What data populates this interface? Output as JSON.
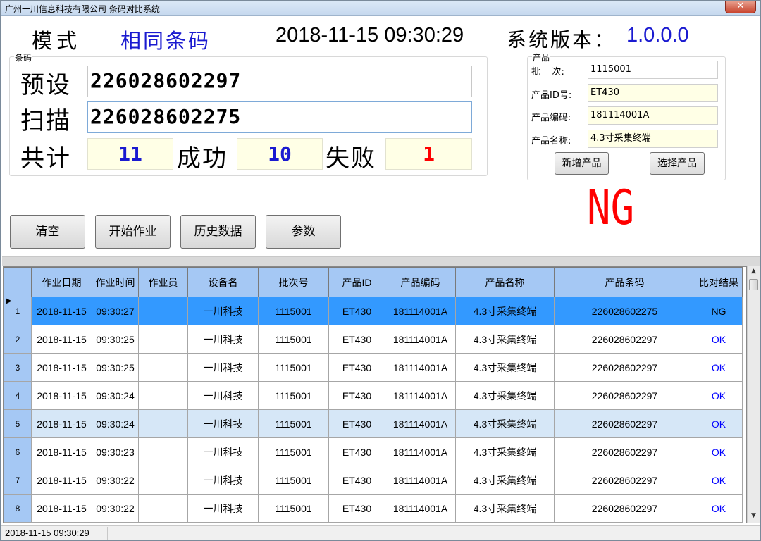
{
  "window": {
    "title": "广州一川信息科技有限公司 条码对比系统",
    "close_label": "✕"
  },
  "header": {
    "mode_label": "模式",
    "mode_value": "相同条码",
    "datetime": "2018-11-15 09:30:29",
    "version_label": "系统版本：",
    "version_value": "1.0.0.0"
  },
  "barcode": {
    "group_title": "条码",
    "preset_label": "预设",
    "preset_value": "226028602297",
    "scan_label": "扫描",
    "scan_value": "226028602275",
    "total_label": "共计",
    "total_value": "11",
    "success_label": "成功",
    "success_value": "10",
    "fail_label": "失败",
    "fail_value": "1"
  },
  "product": {
    "group_title": "产品",
    "batch_label": "批    次:",
    "batch_value": "1115001",
    "id_label": "产品ID号:",
    "id_value": "ET430",
    "code_label": "产品编码:",
    "code_value": "181114001A",
    "name_label": "产品名称:",
    "name_value": "4.3寸采集终端",
    "add_button": "新增产品",
    "select_button": "选择产品"
  },
  "result": {
    "text": "NG",
    "color": "#ff0000"
  },
  "actions": {
    "clear": "清空",
    "start": "开始作业",
    "history": "历史数据",
    "params": "参数"
  },
  "table": {
    "columns": [
      "作业日期",
      "作业时间",
      "作业员",
      "设备名",
      "批次号",
      "产品ID",
      "产品编码",
      "产品名称",
      "产品条码",
      "比对结果"
    ],
    "rows": [
      {
        "no": "1",
        "date": "2018-11-15",
        "time": "09:30:27",
        "operator": "",
        "device": "一川科技",
        "batch": "1115001",
        "pid": "ET430",
        "pcode": "181114001A",
        "pname": "4.3寸采集终端",
        "barcode": "226028602275",
        "result": "NG"
      },
      {
        "no": "2",
        "date": "2018-11-15",
        "time": "09:30:25",
        "operator": "",
        "device": "一川科技",
        "batch": "1115001",
        "pid": "ET430",
        "pcode": "181114001A",
        "pname": "4.3寸采集终端",
        "barcode": "226028602297",
        "result": "OK"
      },
      {
        "no": "3",
        "date": "2018-11-15",
        "time": "09:30:25",
        "operator": "",
        "device": "一川科技",
        "batch": "1115001",
        "pid": "ET430",
        "pcode": "181114001A",
        "pname": "4.3寸采集终端",
        "barcode": "226028602297",
        "result": "OK"
      },
      {
        "no": "4",
        "date": "2018-11-15",
        "time": "09:30:24",
        "operator": "",
        "device": "一川科技",
        "batch": "1115001",
        "pid": "ET430",
        "pcode": "181114001A",
        "pname": "4.3寸采集终端",
        "barcode": "226028602297",
        "result": "OK"
      },
      {
        "no": "5",
        "date": "2018-11-15",
        "time": "09:30:24",
        "operator": "",
        "device": "一川科技",
        "batch": "1115001",
        "pid": "ET430",
        "pcode": "181114001A",
        "pname": "4.3寸采集终端",
        "barcode": "226028602297",
        "result": "OK"
      },
      {
        "no": "6",
        "date": "2018-11-15",
        "time": "09:30:23",
        "operator": "",
        "device": "一川科技",
        "batch": "1115001",
        "pid": "ET430",
        "pcode": "181114001A",
        "pname": "4.3寸采集终端",
        "barcode": "226028602297",
        "result": "OK"
      },
      {
        "no": "7",
        "date": "2018-11-15",
        "time": "09:30:22",
        "operator": "",
        "device": "一川科技",
        "batch": "1115001",
        "pid": "ET430",
        "pcode": "181114001A",
        "pname": "4.3寸采集终端",
        "barcode": "226028602297",
        "result": "OK"
      },
      {
        "no": "8",
        "date": "2018-11-15",
        "time": "09:30:22",
        "operator": "",
        "device": "一川科技",
        "batch": "1115001",
        "pid": "ET430",
        "pcode": "181114001A",
        "pname": "4.3寸采集终端",
        "barcode": "226028602297",
        "result": "OK"
      }
    ]
  },
  "statusbar": {
    "text": "2018-11-15 09:30:29"
  },
  "colors": {
    "accent": "#1a1ad0",
    "ok": "#0000ff",
    "ng": "#ff0000",
    "selected_row": "#3399ff",
    "header_bg": "#a5c8f4"
  }
}
